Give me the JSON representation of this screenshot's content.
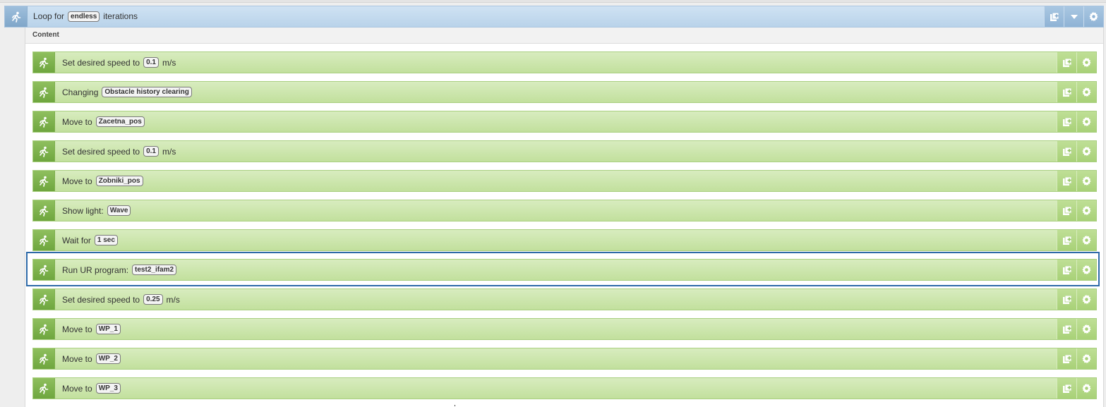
{
  "loop": {
    "prefix": "Loop for",
    "value": "endless",
    "suffix": "iterations"
  },
  "content": {
    "label": "Content"
  },
  "rows": [
    {
      "name": "row-set-speed-1",
      "prefix": "Set desired speed to",
      "value": "0.1",
      "suffix": "m/s"
    },
    {
      "name": "row-changing",
      "prefix": "Changing",
      "value": "Obstacle history clearing",
      "suffix": ""
    },
    {
      "name": "row-move-zacetna",
      "prefix": "Move to",
      "value": "Zacetna_pos",
      "suffix": ""
    },
    {
      "name": "row-set-speed-2",
      "prefix": "Set desired speed to",
      "value": "0.1",
      "suffix": "m/s"
    },
    {
      "name": "row-move-zobniki",
      "prefix": "Move to",
      "value": "Zobniki_pos",
      "suffix": ""
    },
    {
      "name": "row-show-light",
      "prefix": "Show light:",
      "value": "Wave",
      "suffix": ""
    },
    {
      "name": "row-wait",
      "prefix": "Wait for",
      "value": "1 sec",
      "suffix": ""
    },
    {
      "name": "row-run-ur-program",
      "prefix": "Run UR program:",
      "value": "test2_ifam2",
      "suffix": ""
    },
    {
      "name": "row-set-speed-3",
      "prefix": "Set desired speed to",
      "value": "0.25",
      "suffix": "m/s"
    },
    {
      "name": "row-move-wp1",
      "prefix": "Move to",
      "value": "WP_1",
      "suffix": ""
    },
    {
      "name": "row-move-wp2",
      "prefix": "Move to",
      "value": "WP_2",
      "suffix": ""
    },
    {
      "name": "row-move-wp3",
      "prefix": "Move to",
      "value": "WP_3",
      "suffix": ""
    }
  ],
  "selected_row": "Run UR program:",
  "colors": {
    "row_green": "#c2e09d",
    "loop_blue": "#b9d3ea",
    "selection_border": "#2e6aa8"
  },
  "icons": {
    "action": "running-person-icon",
    "copy": "copy-add-icon",
    "settings": "gear-icon",
    "collapse": "chevron-down-icon"
  }
}
